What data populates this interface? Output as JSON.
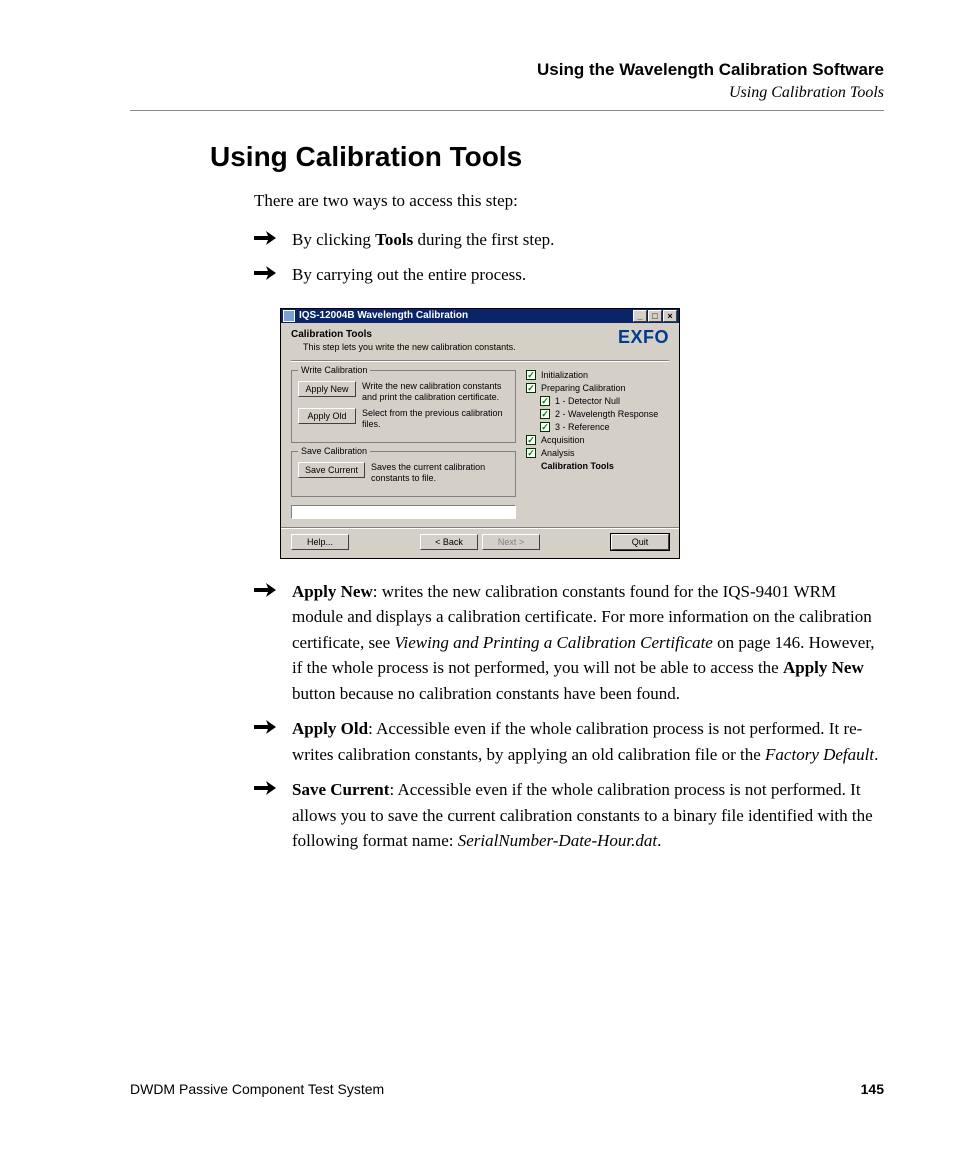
{
  "header": {
    "chapter": "Using the Wavelength Calibration Software",
    "section": "Using Calibration Tools"
  },
  "title": "Using Calibration Tools",
  "intro": "There are two ways to access this step:",
  "bullets_top": [
    {
      "before": "By clicking ",
      "bold": "Tools",
      "after": " during the first step."
    },
    {
      "before": "By carrying out the entire process.",
      "bold": "",
      "after": ""
    }
  ],
  "dialog": {
    "window_title": "IQS-12004B Wavelength Calibration",
    "brand": "EXFO",
    "step_title": "Calibration Tools",
    "step_desc": "This step lets you write the new calibration constants.",
    "group_write": "Write Calibration",
    "group_save": "Save Calibration",
    "btn_apply_new": "Apply New",
    "btn_apply_new_desc": "Write the new calibration constants and print the calibration certificate.",
    "btn_apply_old": "Apply Old",
    "btn_apply_old_desc": "Select from the previous calibration files.",
    "btn_save_current": "Save Current",
    "btn_save_current_desc": "Saves the current calibration constants to file.",
    "steps": {
      "s1": "Initialization",
      "s2": "Preparing Calibration",
      "s2a": "1 - Detector Null",
      "s2b": "2 - Wavelength Response",
      "s2c": "3 - Reference",
      "s3": "Acquisition",
      "s4": "Analysis",
      "s5": "Calibration Tools"
    },
    "btn_help": "Help...",
    "btn_back": "< Back",
    "btn_next": "Next >",
    "btn_quit": "Quit"
  },
  "bullets_bottom": {
    "b1": {
      "head": "Apply New",
      "t1": ": writes the new calibration constants found for the IQS-9401 WRM module and displays a calibration certificate. For more information on the calibration certificate, see ",
      "i1": "Viewing and Printing a Calibration Certificate",
      "t2": " on page 146. However, if the whole process is not performed, you will not be able to access the ",
      "b2": "Apply New",
      "t3": " button because no calibration constants have been found."
    },
    "b2": {
      "head": "Apply Old",
      "t1": ": Accessible even if the whole calibration process is not performed. It re-writes calibration constants, by applying an old calibration file or the ",
      "i1": "Factory Default",
      "t2": "."
    },
    "b3": {
      "head": "Save Current",
      "t1": ": Accessible even if the whole calibration process is not performed. It allows you to save the current calibration constants to a binary file identified with the following format name: ",
      "i1": "SerialNumber-Date-Hour.dat",
      "t2": "."
    }
  },
  "footer": {
    "product": "DWDM Passive Component Test System",
    "page": "145"
  }
}
